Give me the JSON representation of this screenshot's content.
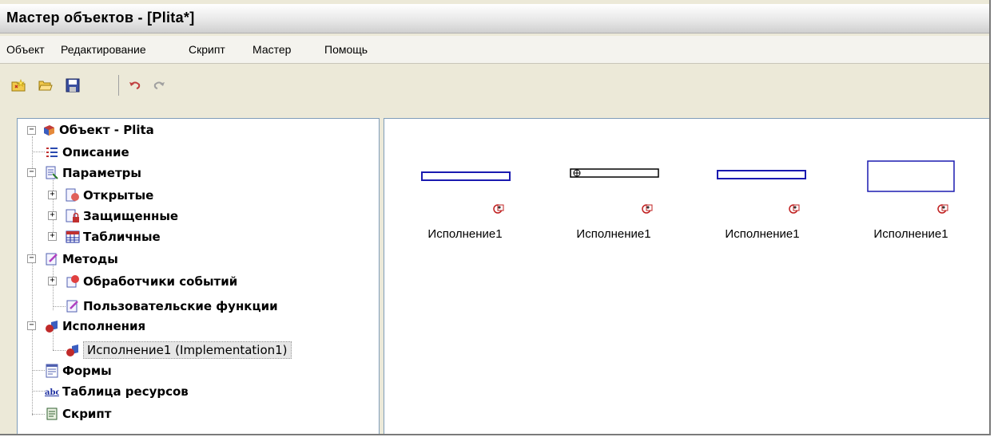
{
  "window": {
    "title": "Мастер объектов - [Plita*]"
  },
  "menu": [
    "Объект",
    "Редактирование",
    "Скрипт",
    "Мастер",
    "Помощь"
  ],
  "toolbar": {
    "buttons": [
      "new-object-icon",
      "open-folder-icon",
      "save-icon",
      "undo-icon",
      "redo-icon"
    ]
  },
  "tree": {
    "root": "Объект - Plita",
    "description": "Описание",
    "parameters": "Параметры",
    "open": "Открытые",
    "protected": "Защищенные",
    "tabular": "Табличные",
    "methods": "Методы",
    "event_handlers": "Обработчики событий",
    "user_functions": "Пользовательские функции",
    "implementations": "Исполнения",
    "implementation1": "Исполнение1 (Implementation1)",
    "forms": "Формы",
    "resource_table": "Таблица ресурсов",
    "script": "Скрипт"
  },
  "canvas": {
    "items": [
      "Исполнение1",
      "Исполнение1",
      "Исполнение1",
      "Исполнение1"
    ]
  },
  "colors": {
    "shape_stroke": "#1a1ab0",
    "marker": "#c02020"
  }
}
